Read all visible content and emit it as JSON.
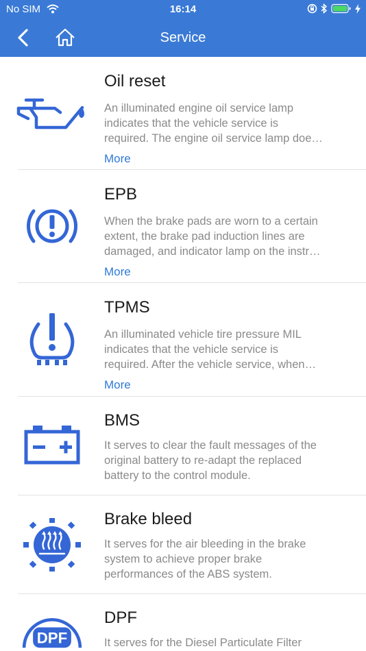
{
  "status": {
    "carrier": "No SIM",
    "time": "16:14"
  },
  "header": {
    "title": "Service"
  },
  "colors": {
    "brand": "#3a7ad6",
    "icon": "#3466d6",
    "link": "#2f7ad6",
    "desc": "#8a8a8a"
  },
  "items": [
    {
      "title": "Oil reset",
      "icon": "oil-can-icon",
      "lines": [
        "An illuminated engine oil service lamp",
        "indicates that the vehicle service is",
        "required. The engine oil service lamp doe…"
      ],
      "more": "More"
    },
    {
      "title": "EPB",
      "icon": "parking-brake-icon",
      "lines": [
        "When the brake pads are worn to a certain",
        "extent, the brake pad induction lines are",
        "damaged, and indicator lamp on the instr…"
      ],
      "more": "More"
    },
    {
      "title": "TPMS",
      "icon": "tire-pressure-icon",
      "lines": [
        "An illuminated vehicle tire pressure MIL",
        "indicates that the vehicle service is",
        "required. After the vehicle service, when…"
      ],
      "more": "More"
    },
    {
      "title": "BMS",
      "icon": "battery-icon",
      "lines": [
        "It serves to clear the fault messages of the",
        "original battery to re-adapt the replaced",
        "battery to the control module."
      ]
    },
    {
      "title": "Brake bleed",
      "icon": "brake-bleed-icon",
      "lines": [
        "It serves for the air bleeding in the brake",
        "system to achieve proper brake",
        "performances of the ABS system."
      ]
    },
    {
      "title": "DPF",
      "icon": "dpf-icon",
      "icon_text": "DPF",
      "lines": [
        "It serves for the Diesel Particulate Filter"
      ]
    }
  ]
}
